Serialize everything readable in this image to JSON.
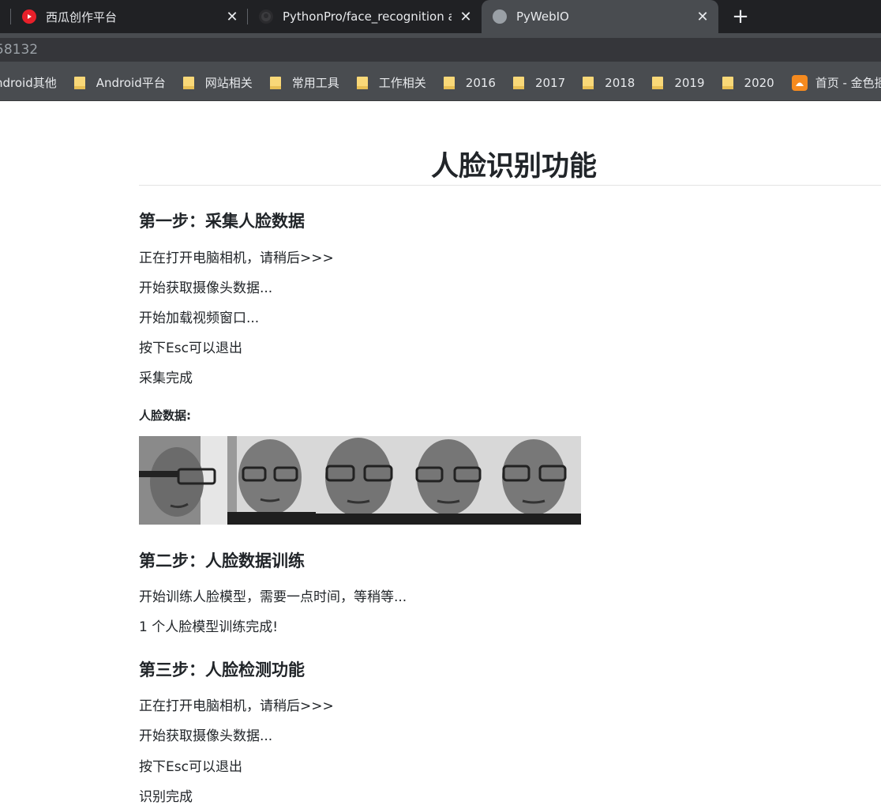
{
  "browser": {
    "tabs": [
      {
        "title": "西瓜创作平台",
        "active": false,
        "icon": "xigua-icon"
      },
      {
        "title": "PythonPro/face_recognition at",
        "active": false,
        "icon": "github-icon"
      },
      {
        "title": "PyWebIO",
        "active": true,
        "icon": "globe-icon"
      }
    ],
    "new_tab_label": "+",
    "close_label": "✕",
    "address": "58132",
    "bookmarks": [
      {
        "label": "ndroid其他",
        "icon": "none"
      },
      {
        "label": "Android平台",
        "icon": "folder-icon"
      },
      {
        "label": "网站相关",
        "icon": "folder-icon"
      },
      {
        "label": "常用工具",
        "icon": "folder-icon"
      },
      {
        "label": "工作相关",
        "icon": "folder-icon"
      },
      {
        "label": "2016",
        "icon": "folder-icon"
      },
      {
        "label": "2017",
        "icon": "folder-icon"
      },
      {
        "label": "2018",
        "icon": "folder-icon"
      },
      {
        "label": "2019",
        "icon": "folder-icon"
      },
      {
        "label": "2020",
        "icon": "folder-icon"
      },
      {
        "label": "首页 - 金色摇",
        "icon": "site-icon"
      }
    ],
    "colors": {
      "tabbar": "#202124",
      "toolbar": "#494c50",
      "accent_orange": "#f58a1f",
      "folder": "#f9d878"
    }
  },
  "page": {
    "title": "人脸识别功能",
    "step1": {
      "heading": "第一步：采集人脸数据",
      "lines": [
        "正在打开电脑相机，请稍后>>>",
        "开始获取摄像头数据...",
        "开始加载视频窗口...",
        "按下Esc可以退出",
        "采集完成"
      ],
      "faces_label": "人脸数据:",
      "face_images": [
        "face-sample-1",
        "face-sample-2",
        "face-sample-3",
        "face-sample-4",
        "face-sample-5"
      ]
    },
    "step2": {
      "heading": "第二步：人脸数据训练",
      "lines": [
        "开始训练人脸模型，需要一点时间，等稍等...",
        "1 个人脸模型训练完成!"
      ]
    },
    "step3": {
      "heading": "第三步：人脸检测功能",
      "lines": [
        "正在打开电脑相机，请稍后>>>",
        "开始获取摄像头数据...",
        "按下Esc可以退出",
        "识别完成"
      ]
    }
  }
}
